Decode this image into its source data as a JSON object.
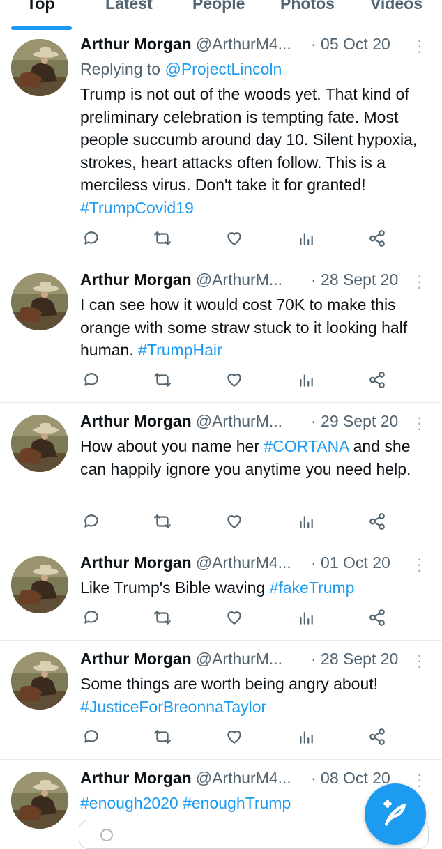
{
  "tabs": [
    {
      "label": "Top",
      "active": true
    },
    {
      "label": "Latest",
      "active": false
    },
    {
      "label": "People",
      "active": false
    },
    {
      "label": "Photos",
      "active": false
    },
    {
      "label": "Videos",
      "active": false
    }
  ],
  "tweets": [
    {
      "name": "Arthur Morgan",
      "handle": "@ArthurM4...",
      "date": "· 05 Oct 20",
      "reply_prefix": "Replying to",
      "reply_mention": "@ProjectLincoln",
      "text": "Trump is not out of the woods yet. That kind of preliminary celebration is tempting fate. Most people succumb around day 10. Silent hypoxia, strokes, heart attacks often follow. This is a merciless virus. Don't take it for granted!",
      "hashtags": "#TrumpCovid19"
    },
    {
      "name": "Arthur Morgan",
      "handle": "@ArthurM...",
      "date": "· 28 Sept 20",
      "text": "I can see how it would cost 70K to make this orange with some straw stuck to it looking half human.",
      "hashtags": "#TrumpHair"
    },
    {
      "name": "Arthur Morgan",
      "handle": "@ArthurM...",
      "date": "· 29 Sept 20",
      "text_before": "How about you name her",
      "inline_tag": "#CORTANA",
      "text_after": "and she can happily ignore you anytime you need help."
    },
    {
      "name": "Arthur Morgan",
      "handle": "@ArthurM4...",
      "date": "· 01 Oct 20",
      "text": "Like Trump's Bible waving",
      "hashtags": "#fakeTrump"
    },
    {
      "name": "Arthur Morgan",
      "handle": "@ArthurM...",
      "date": "· 28 Sept 20",
      "text": "Some things are worth being angry about!",
      "hashtags": "#JusticeForBreonnaTaylor"
    },
    {
      "name": "Arthur Morgan",
      "handle": "@ArthurM4...",
      "date": "· 08 Oct 20",
      "hashtags": "#enough2020 #enoughTrump"
    }
  ],
  "icons": {
    "reply": "reply-icon",
    "retweet": "retweet-icon",
    "like": "heart-icon",
    "analytics": "analytics-icon",
    "share": "share-icon",
    "compose": "compose-tweet-icon"
  },
  "colors": {
    "accent": "#1d9bf0",
    "text": "#0f1419",
    "secondary": "#536471"
  }
}
